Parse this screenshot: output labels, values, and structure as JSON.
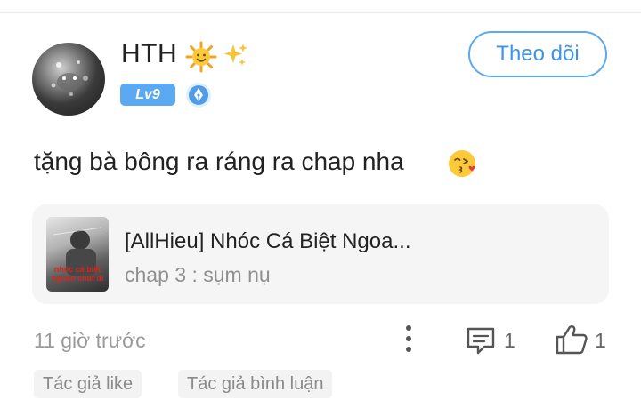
{
  "user": {
    "name": "HTH",
    "level": "Lv9"
  },
  "follow_button": "Theo dõi",
  "comment": {
    "text": "tặng bà bông ra ráng ra chap nha"
  },
  "card": {
    "title": "[AllHieu] Nhóc Cá Biệt Ngoa...",
    "subtitle": "chap 3 : sụm nụ",
    "cover_caption": "nhóc cá biệt ngoan chút đi"
  },
  "footer": {
    "timestamp": "11 giờ trước",
    "comment_count": "1",
    "like_count": "1"
  },
  "tags": [
    "Tác giả like",
    "Tác giả bình luận"
  ],
  "colors": {
    "accent": "#5aa9f2",
    "card_bg": "#f5f5f5",
    "muted_text": "#9a9a9a"
  },
  "icons": {
    "status": [
      "sun-emoji",
      "sparkles-emoji"
    ],
    "badge": "pen-nib-icon",
    "comment_emoji": "kissing-heart-emoji",
    "actions": [
      "more-vertical-icon",
      "comment-icon",
      "thumbs-up-icon"
    ]
  }
}
